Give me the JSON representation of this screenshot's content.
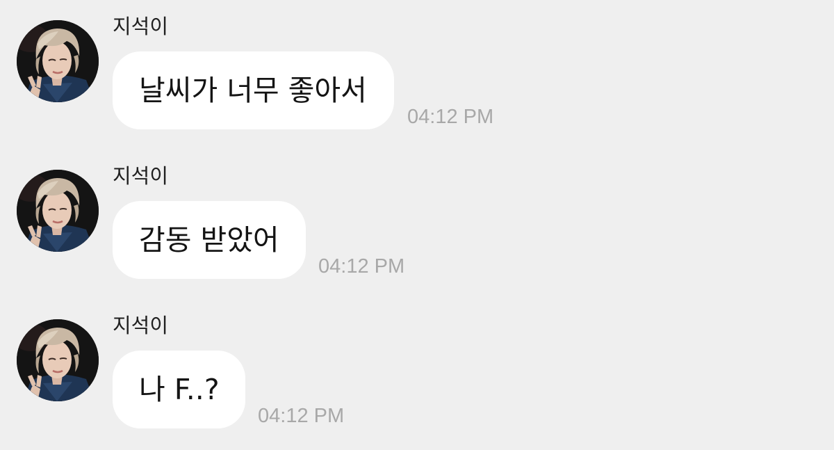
{
  "colors": {
    "background": "#efefef",
    "bubble": "#ffffff",
    "timestamp": "#a8a8a8"
  },
  "messages": [
    {
      "sender": "지석이",
      "text": "날씨가 너무 좋아서",
      "time": "04:12 PM",
      "avatar_icon": "profile-photo"
    },
    {
      "sender": "지석이",
      "text": "감동 받았어",
      "time": "04:12 PM",
      "avatar_icon": "profile-photo"
    },
    {
      "sender": "지석이",
      "text": "나 F..?",
      "time": "04:12 PM",
      "avatar_icon": "profile-photo"
    }
  ]
}
